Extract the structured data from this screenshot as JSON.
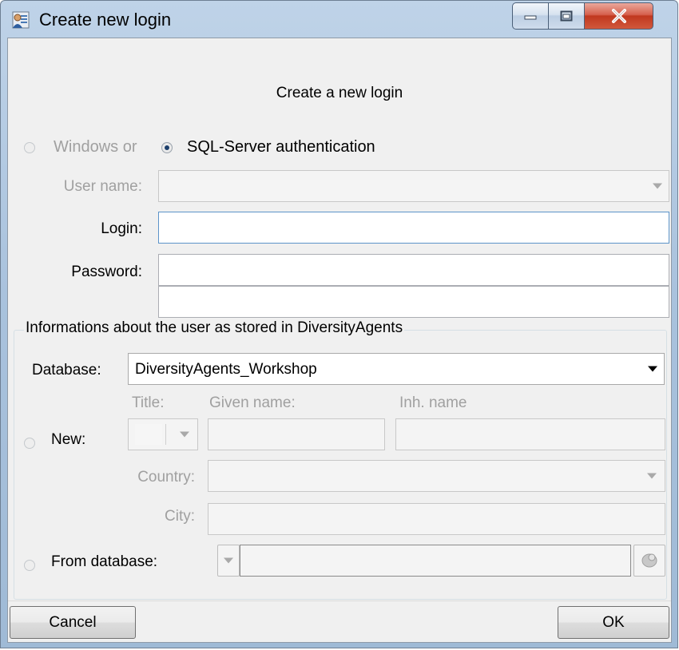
{
  "window": {
    "title": "Create new login",
    "minimize_label": "",
    "maximize_label": "",
    "close_label": ""
  },
  "header": {
    "text": "Create a new login"
  },
  "auth": {
    "windows_label": "Windows or",
    "sql_label": "SQL-Server authentication",
    "selected": "sql"
  },
  "form": {
    "user_name_label": "User name:",
    "user_name_value": "",
    "login_label": "Login:",
    "login_value": "",
    "password_label": "Password:",
    "password_value": "",
    "password_confirm_value": ""
  },
  "agents": {
    "group_title": "Informations about the user as stored in DiversityAgents",
    "database_label": "Database:",
    "database_value": "DiversityAgents_Workshop",
    "new_label": "New:",
    "title_label": "Title:",
    "given_name_label": "Given name:",
    "inh_name_label": "Inh. name",
    "country_label": "Country:",
    "city_label": "City:",
    "from_database_label": "From database:"
  },
  "footer": {
    "cancel_label": "Cancel",
    "ok_label": "OK"
  },
  "colors": {
    "accent": "#1d3f6b",
    "disabled_text": "#a0a0a0",
    "close_button": "#c0381f"
  }
}
